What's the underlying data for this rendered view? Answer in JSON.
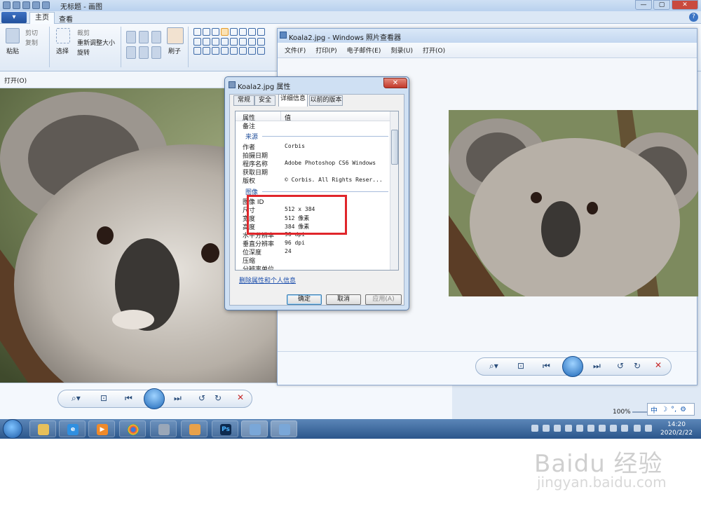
{
  "paint": {
    "title": "无标题 - 画图",
    "app_menu": "▾",
    "tabs": [
      "主页",
      "查看"
    ],
    "clipboard": {
      "paste": "粘贴",
      "cut": "剪切",
      "copy": "复制"
    },
    "image": {
      "select": "选择",
      "crop": "裁剪",
      "resize": "重新调整大小",
      "rotate": "旋转"
    },
    "brush": "刷子",
    "open_menu": "打开(O)",
    "zoom": "100%"
  },
  "viewer": {
    "title": "Koala2.jpg - Windows 照片查看器",
    "menu": [
      "文件(F)",
      "打印(P)",
      "电子邮件(E)",
      "刻录(U)",
      "打开(O)"
    ]
  },
  "dialog": {
    "title": "Koala2.jpg 属性",
    "close": "✕",
    "tabs": [
      "常规",
      "安全",
      "详细信息",
      "以前的版本"
    ],
    "col_property": "属性",
    "col_value": "值",
    "row_top": "备注",
    "section_origin": "来源",
    "origin_rows": [
      {
        "k": "作者",
        "v": "Corbis"
      },
      {
        "k": "拍摄日期",
        "v": ""
      },
      {
        "k": "程序名称",
        "v": "Adobe Photoshop CS6 Windows"
      },
      {
        "k": "获取日期",
        "v": ""
      },
      {
        "k": "版权",
        "v": "© Corbis.  All Rights Reser..."
      }
    ],
    "section_image": "图像",
    "image_rows": [
      {
        "k": "图像 ID",
        "v": ""
      },
      {
        "k": "尺寸",
        "v": "512 x 384"
      },
      {
        "k": "宽度",
        "v": "512 像素"
      },
      {
        "k": "高度",
        "v": "384 像素"
      },
      {
        "k": "水平分辨率",
        "v": "96 dpi"
      },
      {
        "k": "垂直分辨率",
        "v": "96 dpi"
      },
      {
        "k": "位深度",
        "v": "24"
      },
      {
        "k": "压缩",
        "v": ""
      },
      {
        "k": "分辨率单位",
        "v": ""
      }
    ],
    "remove_link": "删除属性和个人信息",
    "ok": "确定",
    "cancel": "取消",
    "apply": "应用(A)"
  },
  "ime": {
    "lang": "中"
  },
  "taskbar": {
    "ps": "Ps",
    "time": "14:20",
    "date": "2020/2/22"
  },
  "watermark": {
    "text": "Baidu 经验",
    "url": "jingyan.baidu.com"
  },
  "colors": {
    "highlight": "#e0262b",
    "accent": "#1f68b8"
  }
}
